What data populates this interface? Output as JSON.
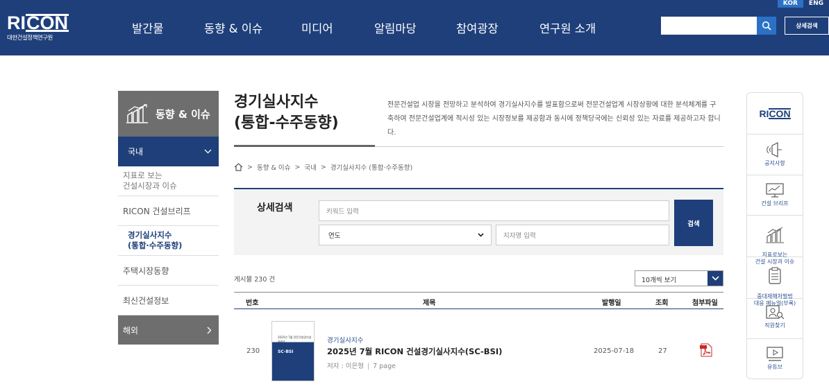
{
  "header": {
    "logo_main": "RICON",
    "logo_sub": "대한건설정책연구원",
    "nav": [
      "발간물",
      "동향 & 이슈",
      "미디어",
      "알림마당",
      "참여광장",
      "연구원 소개"
    ],
    "lang_kor": "KOR",
    "lang_eng": "ENG",
    "search_placeholder": "",
    "advanced_search": "상세검색"
  },
  "sidebar": {
    "title": "동향 & 이슈",
    "domestic": "국내",
    "items": [
      {
        "label": "지표로 보는\n건설시장과 이슈"
      },
      {
        "label": "RICON 건설브리프"
      },
      {
        "label": "경기실사지수\n(통합·수주동향)"
      },
      {
        "label": "주택시장동향"
      },
      {
        "label": "최신건설정보"
      }
    ],
    "foreign": "해외"
  },
  "page": {
    "title_line1": "경기실사지수",
    "title_line2": "(통합-수주동향)",
    "description": "전문건설업 시장을 전망하고 분석하여 경기실사지수를 발표함으로써 전문건설업계 시장상황에 대한 분석체계를 구축하여 전문건설업계에 적시성 있는 시장정보를 제공함과 동시에 정책당국에는 신뢰성 있는 자료를 제공하고자 합니다.",
    "breadcrumb": [
      "동향 & 이슈",
      "국내",
      "경기실사지수 (통합·수주동향)"
    ]
  },
  "search": {
    "label": "상세검색",
    "keyword_placeholder": "키워드 입력",
    "year_value": "연도",
    "region_placeholder": "지자명 입력",
    "button": "검색"
  },
  "list": {
    "count_text": "게시물 230 건",
    "per_page": "10개씩 보기",
    "headers": {
      "num": "번호",
      "title": "제목",
      "date": "발행일",
      "views": "조회",
      "file": "첨부파일"
    },
    "rows": [
      {
        "num": "230",
        "thumb_top": "2025년 7월 전문건설경기실사지수",
        "thumb_label": "SC-BSI",
        "category": "경기실사지수",
        "title": "2025년 7월 RICON 건설경기실사지수(SC-BSI)",
        "author": "저자 : 이은형",
        "pages": "7 page",
        "date": "2025-07-18",
        "views": "27"
      }
    ]
  },
  "quick_menu": {
    "logo": "RICON",
    "items": [
      {
        "label": "공지사항",
        "icon": "megaphone-icon"
      },
      {
        "label": "건설 브리프",
        "icon": "monitor-chart-icon"
      },
      {
        "label": "지표로보는\n건설 시장과 이슈",
        "icon": "building-chart-icon"
      },
      {
        "label": "중대재해처벌법\n대응 메뉴얼(부록)",
        "icon": "clipboard-icon"
      },
      {
        "label": "직원찾기",
        "icon": "person-search-icon"
      },
      {
        "label": "유튜브",
        "icon": "video-icon"
      }
    ]
  }
}
